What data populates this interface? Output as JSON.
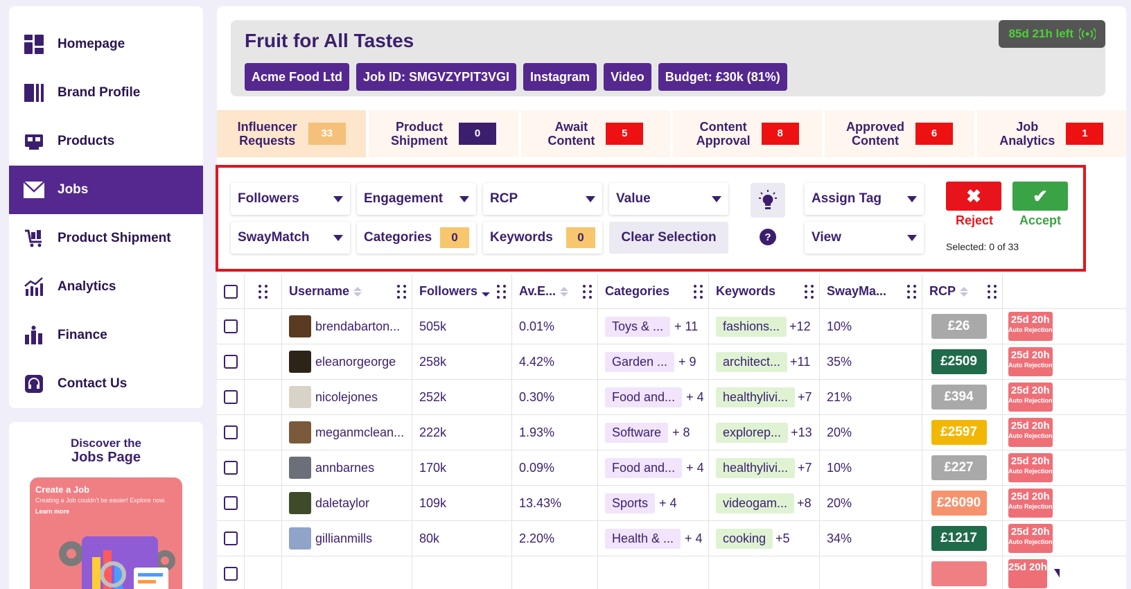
{
  "sidebar": {
    "items": [
      {
        "label": "Homepage",
        "icon": "dashboard-icon"
      },
      {
        "label": "Brand Profile",
        "icon": "brand-icon"
      },
      {
        "label": "Products",
        "icon": "products-icon"
      },
      {
        "label": "Jobs",
        "icon": "mail-icon",
        "active": true
      },
      {
        "label": "Product Shipment",
        "icon": "cart-icon"
      },
      {
        "label": "Analytics",
        "icon": "chart-icon"
      },
      {
        "label": "Finance",
        "icon": "finance-icon"
      },
      {
        "label": "Contact Us",
        "icon": "headset-icon"
      }
    ]
  },
  "promo": {
    "title_line1": "Discover the",
    "title_line2": "Jobs Page",
    "card_heading": "Create a Job",
    "card_sub": "Creating a Job couldn't be easier! Explore now.",
    "card_link": "Learn more"
  },
  "job": {
    "title": "Fruit for All Tastes",
    "timer": "85d 21h left",
    "chips": [
      "Acme Food Ltd",
      "Job ID: SMGVZYPIT3VGI",
      "Instagram",
      "Video",
      "Budget: £30k (81%)"
    ]
  },
  "tabs": [
    {
      "line1": "Influencer",
      "line2": "Requests",
      "count": "33",
      "color": "orange",
      "active": true
    },
    {
      "line1": "Product",
      "line2": "Shipment",
      "count": "0",
      "color": "purple"
    },
    {
      "line1": "Await",
      "line2": "Content",
      "count": "5",
      "color": "red"
    },
    {
      "line1": "Content",
      "line2": "Approval",
      "count": "8",
      "color": "red"
    },
    {
      "line1": "Approved",
      "line2": "Content",
      "count": "6",
      "color": "red"
    },
    {
      "line1": "Job",
      "line2": "Analytics",
      "count": "1",
      "color": "red"
    }
  ],
  "filters": {
    "followers": "Followers",
    "engagement": "Engagement",
    "rcp": "RCP",
    "value": "Value",
    "swaymatch": "SwayMatch",
    "categories": "Categories",
    "categories_count": "0",
    "keywords": "Keywords",
    "keywords_count": "0",
    "clear": "Clear Selection",
    "assign_tag": "Assign Tag",
    "view": "View",
    "help": "?",
    "reject": "Reject",
    "accept": "Accept",
    "selected": "Selected: 0 of 33"
  },
  "table": {
    "headers": {
      "username": "Username",
      "followers": "Followers",
      "av_eng": "Av.E...",
      "categories": "Categories",
      "keywords": "Keywords",
      "swaymatch": "SwayMa...",
      "rcp": "RCP"
    },
    "rows": [
      {
        "user": "brendabarton...",
        "followers": "505k",
        "av": "0.01%",
        "cat": "Toys & ...",
        "cat_more": "+ 11",
        "kw": "fashions...",
        "kw_more": "+12",
        "sm": "10%",
        "rcp": "£26",
        "rcp_color": "#a9a9a9",
        "rej": "25d 20h",
        "rej_sub": "Auto Rejection",
        "av_color": "#5a3a20"
      },
      {
        "user": "eleanorgeorge",
        "followers": "258k",
        "av": "4.42%",
        "cat": "Garden ...",
        "cat_more": "+ 9",
        "kw": "architect...",
        "kw_more": "+11",
        "sm": "35%",
        "rcp": "£2509",
        "rcp_color": "#1f6b4a",
        "rej": "25d 20h",
        "rej_sub": "Auto Rejection",
        "av_color": "#2c2418"
      },
      {
        "user": "nicolejones",
        "followers": "252k",
        "av": "0.30%",
        "cat": "Food and...",
        "cat_more": "+ 4",
        "kw": "healthylivi...",
        "kw_more": "+7",
        "sm": "21%",
        "rcp": "£394",
        "rcp_color": "#a9a9a9",
        "rej": "25d 20h",
        "rej_sub": "Auto Rejection",
        "av_color": "#d9d2c8"
      },
      {
        "user": "meganmclean...",
        "followers": "222k",
        "av": "1.93%",
        "cat": "Software",
        "cat_more": "+ 8",
        "kw": "explorep...",
        "kw_more": "+13",
        "sm": "20%",
        "rcp": "£2597",
        "rcp_color": "#f2b705",
        "rej": "25d 20h",
        "rej_sub": "Auto Rejection",
        "av_color": "#7a5a3a"
      },
      {
        "user": "annbarnes",
        "followers": "170k",
        "av": "0.09%",
        "cat": "Food and...",
        "cat_more": "+ 4",
        "kw": "healthylivi...",
        "kw_more": "+7",
        "sm": "10%",
        "rcp": "£227",
        "rcp_color": "#a9a9a9",
        "rej": "25d 20h",
        "rej_sub": "Auto Rejection",
        "av_color": "#6b6f7a"
      },
      {
        "user": "daletaylor",
        "followers": "109k",
        "av": "13.43%",
        "cat": "Sports",
        "cat_more": "+ 4",
        "kw": "videogam...",
        "kw_more": "+8",
        "sm": "20%",
        "rcp": "£26090",
        "rcp_color": "#f7926e",
        "rej": "25d 20h",
        "rej_sub": "Auto Rejection",
        "av_color": "#3e4a2a"
      },
      {
        "user": "gillianmills",
        "followers": "80k",
        "av": "2.20%",
        "cat": "Health & ...",
        "cat_more": "+ 4",
        "kw": "cooking",
        "kw_more": "+5",
        "sm": "34%",
        "rcp": "£1217",
        "rcp_color": "#1f6b4a",
        "rej": "25d 20h",
        "rej_sub": "Auto Rejection",
        "av_color": "#8fa4c8"
      },
      {
        "user": "",
        "followers": "",
        "av": "",
        "cat": "",
        "cat_more": "",
        "kw": "",
        "kw_more": "",
        "sm": "",
        "rcp": "",
        "rcp_color": "#f07f84",
        "rej": "25d 20h",
        "rej_sub": "",
        "av_color": "#ffffff"
      }
    ]
  },
  "colors": {
    "brand": "#54288f",
    "text": "#3b1f6e",
    "reject": "#e8141b",
    "accept": "#3aa346",
    "highlight_border": "#e1151f"
  }
}
